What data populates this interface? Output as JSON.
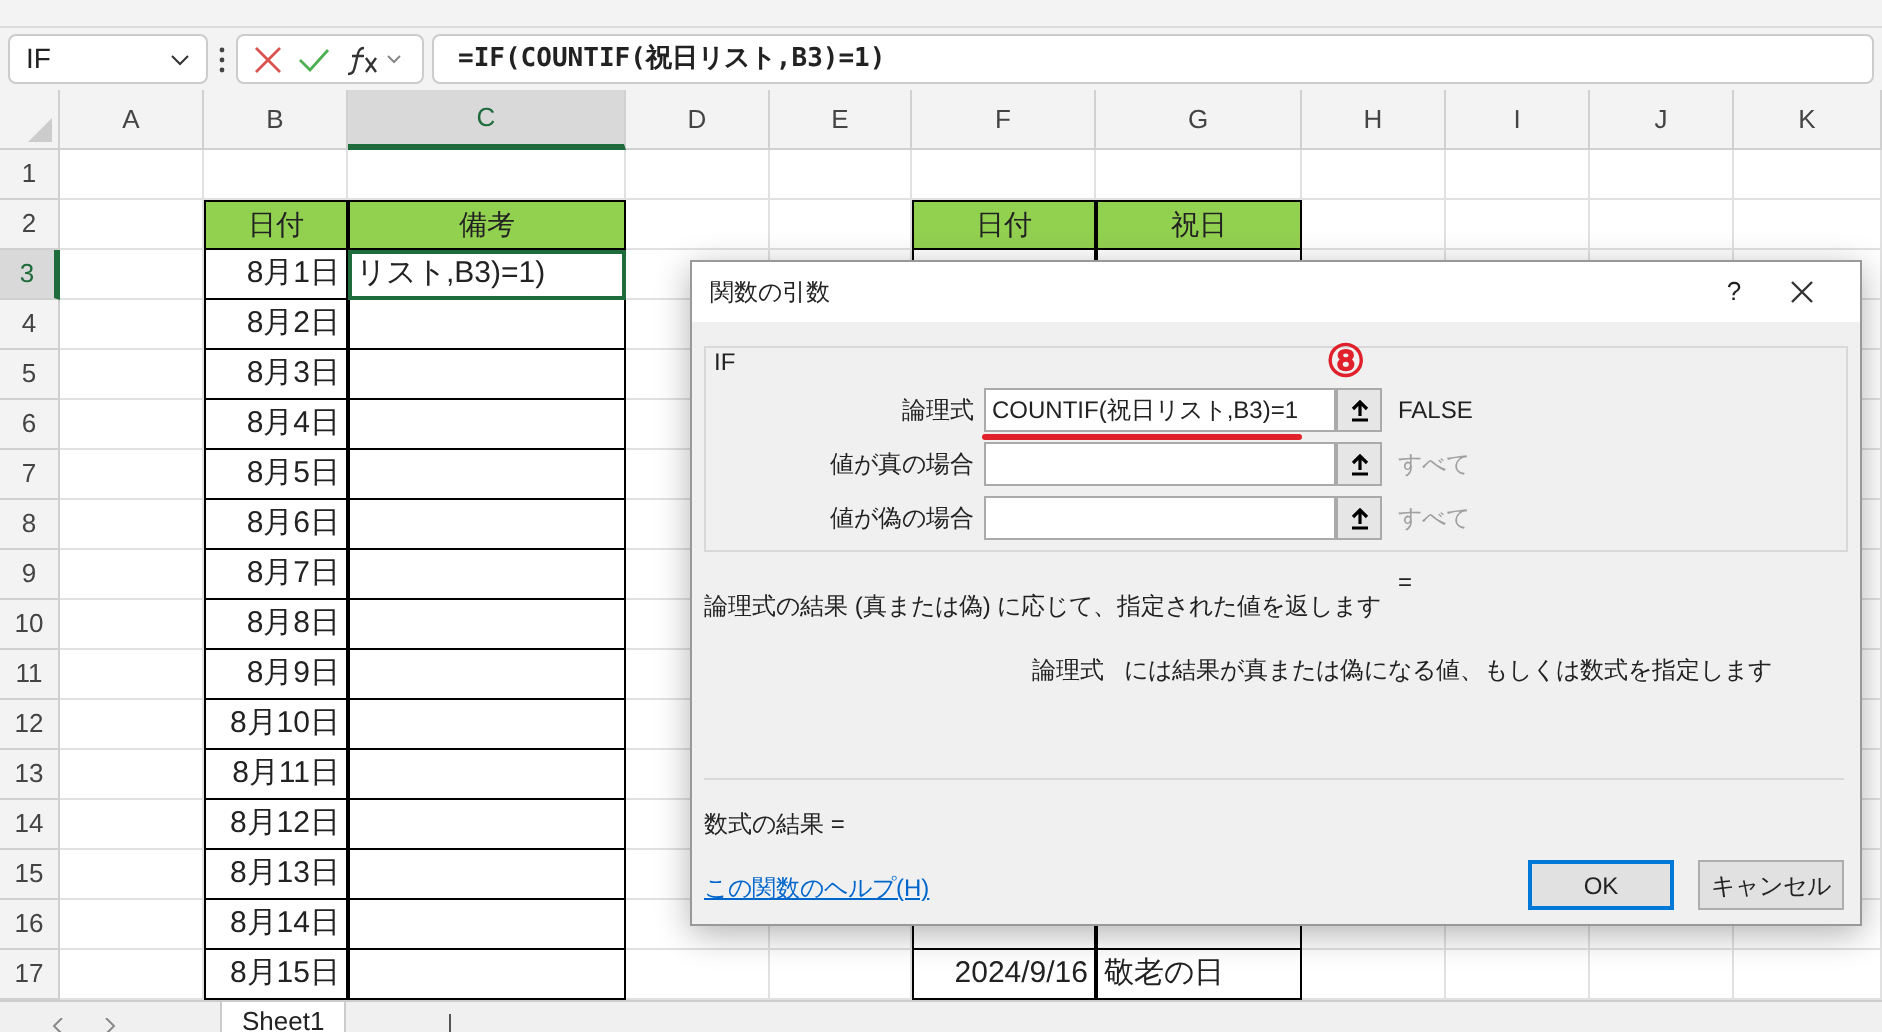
{
  "name_box": {
    "value": "IF"
  },
  "formula_bar": {
    "formula": "=IF(COUNTIF(祝日リスト,B3)=1)"
  },
  "columns": [
    {
      "label": "A",
      "selected": false
    },
    {
      "label": "B",
      "selected": false
    },
    {
      "label": "C",
      "selected": true
    },
    {
      "label": "D",
      "selected": false
    },
    {
      "label": "E",
      "selected": false
    },
    {
      "label": "F",
      "selected": false
    },
    {
      "label": "G",
      "selected": false
    },
    {
      "label": "H",
      "selected": false
    },
    {
      "label": "I",
      "selected": false
    },
    {
      "label": "J",
      "selected": false
    },
    {
      "label": "K",
      "selected": false
    }
  ],
  "rows": [
    {
      "number": "1",
      "selected": false,
      "kind": "blank"
    },
    {
      "number": "2",
      "selected": false,
      "kind": "header",
      "B": "日付",
      "C": "備考",
      "F": "日付",
      "G": "祝日"
    },
    {
      "number": "3",
      "selected": true,
      "kind": "data",
      "B": "8月1日",
      "C": "リスト,B3)=1)"
    },
    {
      "number": "4",
      "selected": false,
      "kind": "data",
      "B": "8月2日"
    },
    {
      "number": "5",
      "selected": false,
      "kind": "data",
      "B": "8月3日"
    },
    {
      "number": "6",
      "selected": false,
      "kind": "data",
      "B": "8月4日"
    },
    {
      "number": "7",
      "selected": false,
      "kind": "data",
      "B": "8月5日"
    },
    {
      "number": "8",
      "selected": false,
      "kind": "data",
      "B": "8月6日"
    },
    {
      "number": "9",
      "selected": false,
      "kind": "data",
      "B": "8月7日"
    },
    {
      "number": "10",
      "selected": false,
      "kind": "data",
      "B": "8月8日"
    },
    {
      "number": "11",
      "selected": false,
      "kind": "data",
      "B": "8月9日"
    },
    {
      "number": "12",
      "selected": false,
      "kind": "data",
      "B": "8月10日"
    },
    {
      "number": "13",
      "selected": false,
      "kind": "data",
      "B": "8月11日"
    },
    {
      "number": "14",
      "selected": false,
      "kind": "data",
      "B": "8月12日"
    },
    {
      "number": "15",
      "selected": false,
      "kind": "data",
      "B": "8月13日"
    },
    {
      "number": "16",
      "selected": false,
      "kind": "data",
      "B": "8月14日"
    },
    {
      "number": "17",
      "selected": false,
      "kind": "data",
      "B": "8月15日",
      "F": "2024/9/16",
      "G": "敬老の日"
    }
  ],
  "dialog": {
    "title": "関数の引数",
    "help": "?",
    "function": "IF",
    "arguments": [
      {
        "label": "論理式",
        "value": "COUNTIF(祝日リスト,B3)=1",
        "result": "FALSE",
        "result_dimmed": false
      },
      {
        "label": "値が真の場合",
        "result": "すべて",
        "result_dimmed": true
      },
      {
        "label": "値が偽の場合",
        "result": "すべて",
        "result_dimmed": true
      }
    ],
    "annotation": {
      "label": "⑧"
    },
    "function_result": "=",
    "description": "論理式の結果 (真または偽) に応じて、指定された値を返します",
    "argument_help": {
      "label": "論理式",
      "text": "には結果が真または偽になる値、もしくは数式を指定します"
    },
    "formula_result": "数式の結果 =",
    "help_link": "この関数のヘルプ(H)",
    "buttons": [
      {
        "label": "OK",
        "selected": true
      },
      {
        "label": "キャンセル",
        "selected": false
      }
    ]
  },
  "sheet_tabs": [
    {
      "label": "Sheet1",
      "selected": true
    }
  ]
}
